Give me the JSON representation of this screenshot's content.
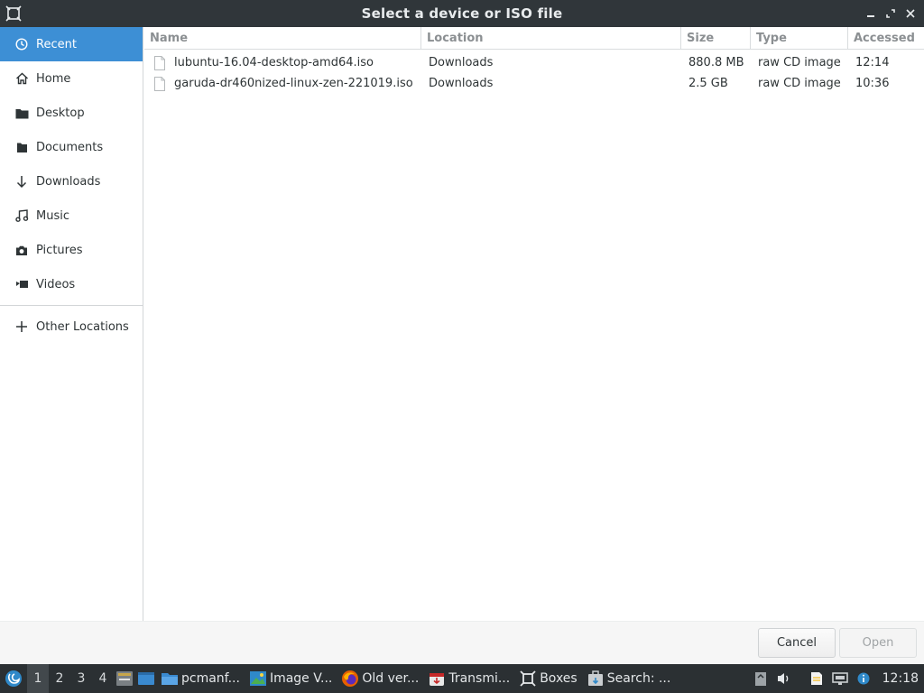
{
  "window": {
    "title": "Select a device or ISO file"
  },
  "sidebar": {
    "items": [
      {
        "label": "Recent",
        "icon": "clock-icon",
        "active": true
      },
      {
        "label": "Home",
        "icon": "home-icon"
      },
      {
        "label": "Desktop",
        "icon": "folder-icon"
      },
      {
        "label": "Documents",
        "icon": "document-icon"
      },
      {
        "label": "Downloads",
        "icon": "download-arrow-icon"
      },
      {
        "label": "Music",
        "icon": "music-note-icon"
      },
      {
        "label": "Pictures",
        "icon": "camera-icon"
      },
      {
        "label": "Videos",
        "icon": "video-icon"
      }
    ],
    "other": {
      "label": "Other Locations",
      "icon": "plus-icon"
    }
  },
  "filelist": {
    "columns": [
      "Name",
      "Location",
      "Size",
      "Type",
      "Accessed"
    ],
    "rows": [
      {
        "name": "lubuntu-16.04-desktop-amd64.iso",
        "location": "Downloads",
        "size": "880.8 MB",
        "type": "raw CD image",
        "accessed": "12:14"
      },
      {
        "name": "garuda-dr460nized-linux-zen-221019.iso",
        "location": "Downloads",
        "size": "2.5 GB",
        "type": "raw CD image",
        "accessed": "10:36"
      }
    ]
  },
  "footer": {
    "cancel_label": "Cancel",
    "open_label": "Open"
  },
  "taskbar": {
    "desktops": [
      "1",
      "2",
      "3",
      "4"
    ],
    "tasks": [
      {
        "label": "pcmanf...",
        "icon": "folder-icon"
      },
      {
        "label": "Image V...",
        "icon": "image-viewer-icon"
      },
      {
        "label": "Old ver...",
        "icon": "firefox-icon"
      },
      {
        "label": "Transmi...",
        "icon": "transmission-icon"
      },
      {
        "label": "Boxes",
        "icon": "boxes-icon"
      },
      {
        "label": "Search: ...",
        "icon": "search-app-icon"
      }
    ],
    "clock": "12:18"
  },
  "colors": {
    "accent": "#3d8fd5",
    "titlebar": "#30363a",
    "taskbar": "#2b3033"
  }
}
